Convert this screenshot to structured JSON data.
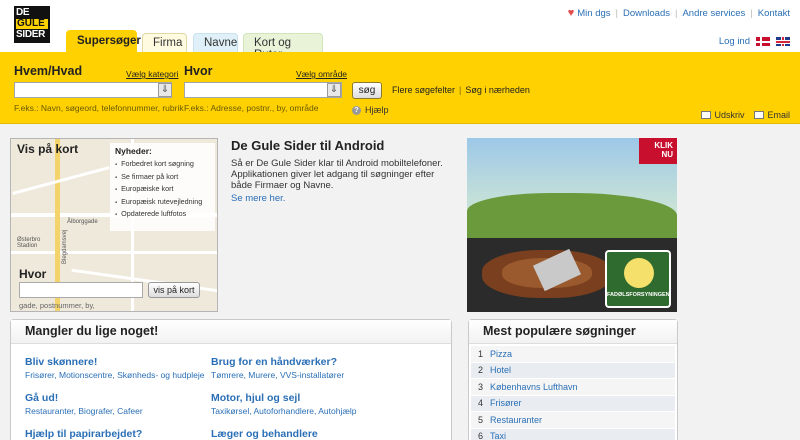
{
  "logo": {
    "line1": "DE",
    "line2": "GULE",
    "line3": "SIDER"
  },
  "toplinks": [
    "Min dgs",
    "Downloads",
    "Andre services",
    "Kontakt"
  ],
  "tabs": [
    "Supersøger",
    "Firma",
    "Navne",
    "Kort og Ruter"
  ],
  "login": "Log ind",
  "search": {
    "what_label": "Hvem/Hvad",
    "what_category_link": "Vælg kategori",
    "what_hint": "F.eks.: Navn, søgeord, telefonnummer, rubrik",
    "where_label": "Hvor",
    "where_area_link": "Vælg område",
    "where_hint": "F.eks.: Adresse, postnr., by, område",
    "search_button": "søg",
    "more_fields": "Flere søgefelter",
    "near_me": "Søg i nærheden",
    "help": "Hjælp",
    "print": "Udskriv",
    "email": "Email"
  },
  "map": {
    "title": "Vis på kort",
    "news_title": "Nyheder:",
    "news": [
      "Forbedret kort søgning",
      "Se firmaer på kort",
      "Europæiske kort",
      "Europæisk rutevejledning",
      "Opdaterede luftfotos"
    ],
    "where_label": "Hvor",
    "button": "vis på kort",
    "hint": "gade, postnummer, by,",
    "streets": [
      "Ålborggade",
      "Østerbro Stadion",
      "Blegdamsvej"
    ]
  },
  "promo": {
    "title": "De Gule Sider til Android",
    "text": "Så er De Gule Sider klar til Android mobiltelefoner. Applikationen giver let adgang til søgninger efter både Firmaer og Navne.",
    "more": "Se mere her."
  },
  "ad": {
    "klik": "KLIK NU",
    "badge": "FADØLSFORSYNINGEN"
  },
  "missing": {
    "title": "Mangler du lige noget!",
    "categories": [
      {
        "title": "Bliv skønnere!",
        "sub": "Frisører, Motionscentre, Skønheds- og hudpleje"
      },
      {
        "title": "Brug for en håndværker?",
        "sub": "Tømrere, Murere, VVS-installatører"
      },
      {
        "title": "Gå ud!",
        "sub": "Restauranter, Biografer, Cafeer"
      },
      {
        "title": "Motor, hjul og sejl",
        "sub": "Taxikørsel, Autoforhandlere, Autohjælp"
      },
      {
        "title": "Hjælp til papirarbejdet?",
        "sub": ""
      },
      {
        "title": "Læger og behandlere",
        "sub": ""
      }
    ]
  },
  "popular": {
    "title": "Mest populære søgninger",
    "items": [
      {
        "n": "1",
        "v": "Pizza"
      },
      {
        "n": "2",
        "v": "Hotel"
      },
      {
        "n": "3",
        "v": "Københavns Lufthavn"
      },
      {
        "n": "4",
        "v": "Frisører"
      },
      {
        "n": "5",
        "v": "Restauranter"
      },
      {
        "n": "6",
        "v": "Taxi"
      }
    ]
  }
}
